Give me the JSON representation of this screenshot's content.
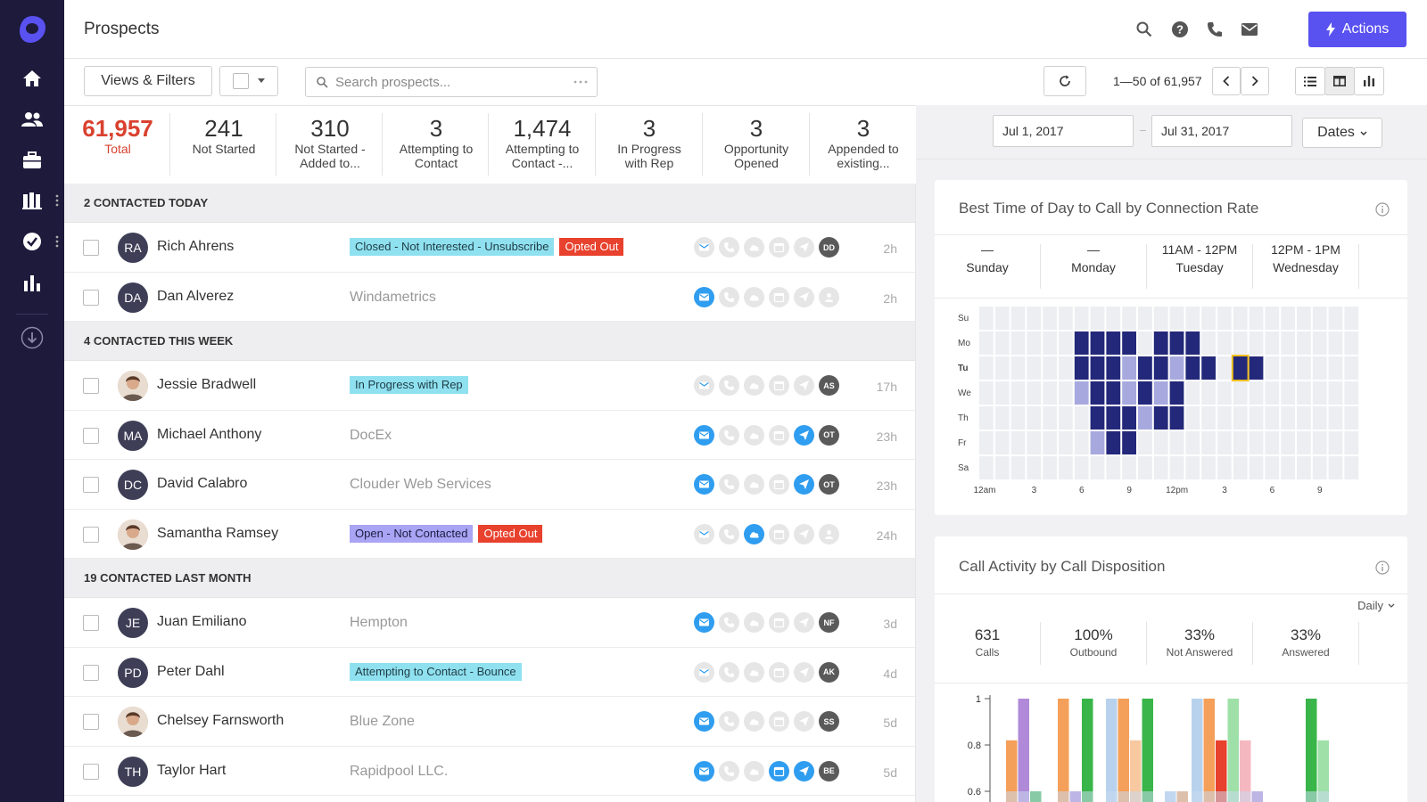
{
  "app": {
    "page_title": "Prospects",
    "actions_label": "Actions",
    "colors": {
      "nav": "#1d1a3b",
      "accent": "#5951f0",
      "danger": "#e8412d",
      "tag_cyan": "#8fe1f0",
      "tag_purple": "#a9a4f3",
      "action_on": "#2f9df0"
    }
  },
  "nav": {
    "icons": [
      "logo-icon",
      "home-icon",
      "people-icon",
      "briefcase-icon",
      "library-icon",
      "check-circle-icon",
      "bar-chart-icon",
      "download-icon"
    ]
  },
  "toolbar": {
    "views_filters": "Views & Filters",
    "search_placeholder": "Search prospects...",
    "pager": "1—50 of 61,957"
  },
  "stats": [
    {
      "value": "61,957",
      "label": "Total"
    },
    {
      "value": "241",
      "label": "Not Started"
    },
    {
      "value": "310",
      "label": "Not Started -\nAdded to..."
    },
    {
      "value": "3",
      "label": "Attempting to\nContact"
    },
    {
      "value": "1,474",
      "label": "Attempting to\nContact -..."
    },
    {
      "value": "3",
      "label": "In Progress\nwith Rep"
    },
    {
      "value": "3",
      "label": "Opportunity\nOpened"
    },
    {
      "value": "3",
      "label": "Appended to\nexisting..."
    }
  ],
  "groups": [
    {
      "title": "2 CONTACTED TODAY",
      "rows": [
        {
          "initials": "RA",
          "name": "Rich Ahrens",
          "tags": [
            {
              "text": "Closed - Not Interested - Unsubscribe",
              "style": "cyan"
            },
            {
              "text": "Opted Out",
              "style": "red"
            }
          ],
          "company": "",
          "active": [],
          "owner": "DD",
          "time": "2h"
        },
        {
          "initials": "DA",
          "name": "Dan Alverez",
          "tags": [],
          "company": "Windametrics",
          "active": [
            0
          ],
          "owner": "",
          "time": "2h"
        }
      ]
    },
    {
      "title": "4 CONTACTED THIS WEEK",
      "rows": [
        {
          "initials": "",
          "photo": true,
          "name": "Jessie Bradwell",
          "tags": [
            {
              "text": "In Progress with Rep",
              "style": "cyan"
            }
          ],
          "company": "",
          "active": [],
          "owner": "AS",
          "time": "17h"
        },
        {
          "initials": "MA",
          "name": "Michael Anthony",
          "tags": [],
          "company": "DocEx",
          "active": [
            0,
            4
          ],
          "owner": "OT",
          "time": "23h"
        },
        {
          "initials": "DC",
          "name": "David Calabro",
          "tags": [],
          "company": "Clouder Web Services",
          "active": [
            0,
            4
          ],
          "owner": "OT",
          "time": "23h"
        },
        {
          "initials": "",
          "photo": true,
          "name": "Samantha Ramsey",
          "tags": [
            {
              "text": "Open - Not Contacted",
              "style": "purple"
            },
            {
              "text": "Opted Out",
              "style": "red"
            }
          ],
          "company": "",
          "active": [
            2
          ],
          "owner": "",
          "time": "24h"
        }
      ]
    },
    {
      "title": "19 CONTACTED LAST MONTH",
      "rows": [
        {
          "initials": "JE",
          "name": "Juan Emiliano",
          "tags": [],
          "company": "Hempton",
          "active": [
            0
          ],
          "owner": "NF",
          "time": "3d"
        },
        {
          "initials": "PD",
          "name": "Peter Dahl",
          "tags": [
            {
              "text": "Attempting to Contact - Bounce",
              "style": "cyan"
            }
          ],
          "company": "",
          "active": [],
          "owner": "AK",
          "time": "4d"
        },
        {
          "initials": "",
          "photo": true,
          "name": "Chelsey Farnsworth",
          "tags": [],
          "company": "Blue Zone",
          "active": [
            0
          ],
          "owner": "SS",
          "time": "5d"
        },
        {
          "initials": "TH",
          "name": "Taylor Hart",
          "tags": [],
          "company": "Rapidpool LLC.",
          "active": [
            0,
            3,
            4
          ],
          "owner": "BE",
          "time": "5d"
        }
      ]
    }
  ],
  "right_panel": {
    "date_from": "Jul 1, 2017",
    "date_to": "Jul 31, 2017",
    "dates_label": "Dates",
    "best_time_title": "Best Time of Day to Call by Connection Rate",
    "best_days": [
      {
        "time": "—",
        "day": "Sunday"
      },
      {
        "time": "—",
        "day": "Monday"
      },
      {
        "time": "11AM - 12PM",
        "day": "Tuesday"
      },
      {
        "time": "12PM - 1PM",
        "day": "Wednesday"
      }
    ],
    "heatmap_days": [
      "Su",
      "Mo",
      "Tu",
      "We",
      "Th",
      "Fr",
      "Sa"
    ],
    "heatmap_hours": [
      "12am",
      "3",
      "6",
      "9",
      "12pm",
      "3",
      "6",
      "9"
    ],
    "call_activity_title": "Call Activity by Call Disposition",
    "interval": "Daily",
    "metrics": [
      {
        "value": "631",
        "label": "Calls"
      },
      {
        "value": "100%",
        "label": "Outbound"
      },
      {
        "value": "33%",
        "label": "Not Answered"
      },
      {
        "value": "33%",
        "label": "Answered"
      }
    ]
  },
  "chart_data": [
    {
      "type": "heatmap",
      "title": "Best Time of Day to Call by Connection Rate",
      "y_categories": [
        "Su",
        "Mo",
        "Tu",
        "We",
        "Th",
        "Fr",
        "Sa"
      ],
      "x_tick_labels": [
        "12am",
        "3",
        "6",
        "9",
        "12pm",
        "3",
        "6",
        "9"
      ],
      "x_hours": 24,
      "levels": "0 = no data, 1 = low, 2 = high",
      "highlight": {
        "day": "Tu",
        "hour": 16
      },
      "values": [
        [
          0,
          0,
          0,
          0,
          0,
          0,
          0,
          0,
          0,
          0,
          0,
          0,
          0,
          0,
          0,
          0,
          0,
          0,
          0,
          0,
          0,
          0,
          0,
          0
        ],
        [
          0,
          0,
          0,
          0,
          0,
          0,
          2,
          2,
          2,
          2,
          0,
          2,
          2,
          2,
          0,
          0,
          0,
          0,
          0,
          0,
          0,
          0,
          0,
          0
        ],
        [
          0,
          0,
          0,
          0,
          0,
          0,
          2,
          2,
          2,
          1,
          2,
          2,
          1,
          2,
          2,
          0,
          0,
          2,
          0,
          0,
          0,
          0,
          0,
          0
        ],
        [
          0,
          0,
          0,
          0,
          0,
          0,
          1,
          2,
          2,
          1,
          2,
          1,
          2,
          0,
          0,
          0,
          0,
          0,
          0,
          0,
          0,
          0,
          0,
          0
        ],
        [
          0,
          0,
          0,
          0,
          0,
          0,
          0,
          2,
          2,
          2,
          1,
          2,
          2,
          0,
          0,
          0,
          0,
          0,
          0,
          0,
          0,
          0,
          0,
          0
        ],
        [
          0,
          0,
          0,
          0,
          0,
          0,
          0,
          1,
          2,
          2,
          0,
          0,
          0,
          0,
          0,
          0,
          0,
          0,
          0,
          0,
          0,
          0,
          0,
          0
        ],
        [
          0,
          0,
          0,
          0,
          0,
          0,
          0,
          0,
          0,
          0,
          0,
          0,
          0,
          0,
          0,
          0,
          0,
          0,
          0,
          0,
          0,
          0,
          0,
          0
        ]
      ]
    },
    {
      "type": "bar",
      "title": "Call Activity by Call Disposition",
      "y_tick_labels": [
        "1",
        "0.8",
        "0.6"
      ],
      "ylim": [
        0.5,
        1.0
      ],
      "bars": [
        {
          "color": "#f5a05a",
          "value": 0.82
        },
        {
          "color": "#b08ad8",
          "value": 1.0
        },
        {
          "color": "#3ab54a",
          "value": 0.6
        },
        {
          "color": "#f5a05a",
          "value": 1.0
        },
        {
          "color": "#b08ad8",
          "value": 0.6
        },
        {
          "color": "#3ab54a",
          "value": 1.0
        },
        {
          "color": "#b8d2ee",
          "value": 1.0
        },
        {
          "color": "#f5a05a",
          "value": 1.0
        },
        {
          "color": "#f8c8a0",
          "value": 0.82
        },
        {
          "color": "#3ab54a",
          "value": 1.0
        },
        {
          "color": "#b8d2ee",
          "value": 0.6
        },
        {
          "color": "#f5a05a",
          "value": 0.6
        },
        {
          "color": "#b8d2ee",
          "value": 1.0
        },
        {
          "color": "#f5a05a",
          "value": 1.0
        },
        {
          "color": "#e8412d",
          "value": 0.82
        },
        {
          "color": "#9fe0a8",
          "value": 1.0
        },
        {
          "color": "#f5b8c0",
          "value": 0.82
        },
        {
          "color": "#b08ad8",
          "value": 0.6
        },
        {
          "color": "#3ab54a",
          "value": 1.0
        },
        {
          "color": "#9fe0a8",
          "value": 0.82
        }
      ]
    }
  ]
}
